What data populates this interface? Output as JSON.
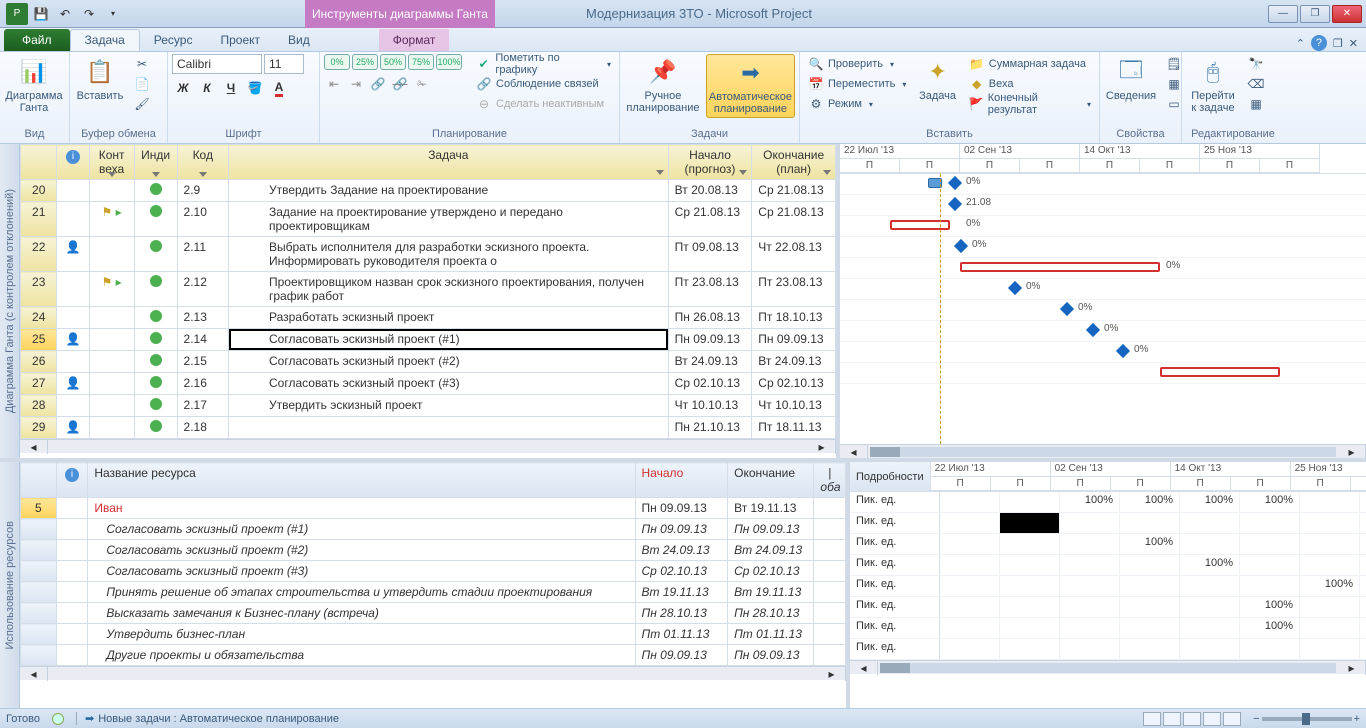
{
  "title": "Модернизация 3ТО - Microsoft Project",
  "contextTab": "Инструменты диаграммы Ганта",
  "fileTab": "Файл",
  "tabs": {
    "task": "Задача",
    "resource": "Ресурс",
    "project": "Проект",
    "view": "Вид",
    "format": "Формат"
  },
  "ribbon": {
    "view": {
      "gantt": "Диаграмма Ганта",
      "label": "Вид"
    },
    "clipboard": {
      "paste": "Вставить",
      "label": "Буфер обмена"
    },
    "font": {
      "name": "Calibri",
      "size": "11",
      "label": "Шрифт"
    },
    "schedule": {
      "pct": [
        "0%",
        "25%",
        "50%",
        "75%",
        "100%"
      ],
      "markTrack": "Пометить по графику",
      "respectLinks": "Соблюдение связей",
      "inactive": "Сделать неактивным",
      "label": "Планирование"
    },
    "tasks": {
      "manual": "Ручное планирование",
      "auto": "Автоматическое планирование",
      "label": "Задачи"
    },
    "insert": {
      "inspect": "Проверить",
      "move": "Переместить",
      "mode": "Режим",
      "task": "Задача",
      "summary": "Суммарная задача",
      "milestone": "Веха",
      "deliverable": "Конечный результат",
      "label": "Вставить"
    },
    "properties": {
      "info": "Сведения",
      "label": "Свойства"
    },
    "editing": {
      "scrollTo": "Перейти к задаче",
      "label": "Редактирование"
    }
  },
  "columns": {
    "info": "",
    "milestone": "Конт веха",
    "indicator": "Инди",
    "wbs": "Код",
    "task": "Задача",
    "forecastStart": "Начало (прогноз)",
    "planFinish": "Окончание (план)"
  },
  "rows": [
    {
      "n": "20",
      "wbs": "2.9",
      "name": "Утвердить Задание на проектирование",
      "start": "Вт 20.08.13",
      "finish": "Ср 21.08.13",
      "ind": "green"
    },
    {
      "n": "21",
      "wbs": "2.10",
      "name": "Задание на проектирование утверждено и передано проектировщикам",
      "start": "Ср 21.08.13",
      "finish": "Ср 21.08.13",
      "ind": "green",
      "flag": "y",
      "flag2": "g"
    },
    {
      "n": "22",
      "wbs": "2.11",
      "name": "Выбрать исполнителя для разработки эскизного проекта. Информировать руководителя проекта о",
      "start": "Пт 09.08.13",
      "finish": "Чт 22.08.13",
      "ind": "green",
      "p": "r"
    },
    {
      "n": "23",
      "wbs": "2.12",
      "name": "Проектировщиком назван срок эскизного проектирования, получен график работ",
      "start": "Пт 23.08.13",
      "finish": "Пт 23.08.13",
      "ind": "green",
      "flag": "y",
      "flag2": "g"
    },
    {
      "n": "24",
      "wbs": "2.13",
      "name": "Разработать эскизный проект",
      "start": "Пн 26.08.13",
      "finish": "Пт 18.10.13",
      "ind": "green"
    },
    {
      "n": "25",
      "wbs": "2.14",
      "name": "Согласовать эскизный проект (#1)",
      "start": "Пн 09.09.13",
      "finish": "Пн 09.09.13",
      "ind": "green",
      "p": "r",
      "sel": true
    },
    {
      "n": "26",
      "wbs": "2.15",
      "name": "Согласовать эскизный проект (#2)",
      "start": "Вт 24.09.13",
      "finish": "Вт 24.09.13",
      "ind": "green"
    },
    {
      "n": "27",
      "wbs": "2.16",
      "name": "Согласовать эскизный проект (#3)",
      "start": "Ср 02.10.13",
      "finish": "Ср 02.10.13",
      "ind": "green",
      "p": "r"
    },
    {
      "n": "28",
      "wbs": "2.17",
      "name": "Утвердить эскизный проект",
      "start": "Чт 10.10.13",
      "finish": "Чт 10.10.13",
      "ind": "green"
    },
    {
      "n": "29",
      "wbs": "2.18",
      "name": "",
      "start": "Пн 21.10.13",
      "finish": "Пт 18.11.13",
      "ind": "green",
      "p": "r"
    }
  ],
  "verticalLeft": "Диаграмма Ганта (с контролем отклонений)",
  "verticalLeft2": "Использование ресурсов",
  "ganttHead": [
    "22 Июл '13",
    "02 Сен '13",
    "14 Окт '13",
    "25 Ноя '13"
  ],
  "ganttSub": "П",
  "ganttLabels": {
    "pct0": "0%",
    "date": "21.08"
  },
  "resCols": {
    "name": "Название ресурса",
    "start": "Начало",
    "finish": "Окончание",
    "cut": "|оба"
  },
  "resRowNum": "5",
  "resRows": [
    {
      "name": "Иван",
      "start": "Пн 09.09.13",
      "finish": "Вт 19.11.13",
      "bold": true
    },
    {
      "name": "Согласовать эскизный проект (#1)",
      "start": "Пн 09.09.13",
      "finish": "Пн 09.09.13",
      "i": true
    },
    {
      "name": "Согласовать эскизный проект (#2)",
      "start": "Вт 24.09.13",
      "finish": "Вт 24.09.13",
      "i": true
    },
    {
      "name": "Согласовать эскизный проект (#3)",
      "start": "Ср 02.10.13",
      "finish": "Ср 02.10.13",
      "i": true
    },
    {
      "name": "Принять решение об этапах строительства  и утвердить стадии проектирования",
      "start": "Вт 19.11.13",
      "finish": "Вт 19.11.13",
      "i": true
    },
    {
      "name": "Высказать замечания к Бизнес-плану (встреча)",
      "start": "Пн 28.10.13",
      "finish": "Пн 28.10.13",
      "i": true
    },
    {
      "name": "Утвердить бизнес-план",
      "start": "Пт 01.11.13",
      "finish": "Пт 01.11.13",
      "i": true
    },
    {
      "name": "Другие проекты и обязательства",
      "start": "Пн 09.09.13",
      "finish": "Пн 09.09.13",
      "i": true
    }
  ],
  "details": {
    "label": "Подробности",
    "rowLabel": "Пик. ед.",
    "pct": "100%",
    "head": [
      "22 Июл '13",
      "02 Сен '13",
      "14 Окт '13",
      "25 Ноя '13"
    ]
  },
  "status": {
    "ready": "Готово",
    "newTasks": "Новые задачи : Автоматическое планирование"
  }
}
